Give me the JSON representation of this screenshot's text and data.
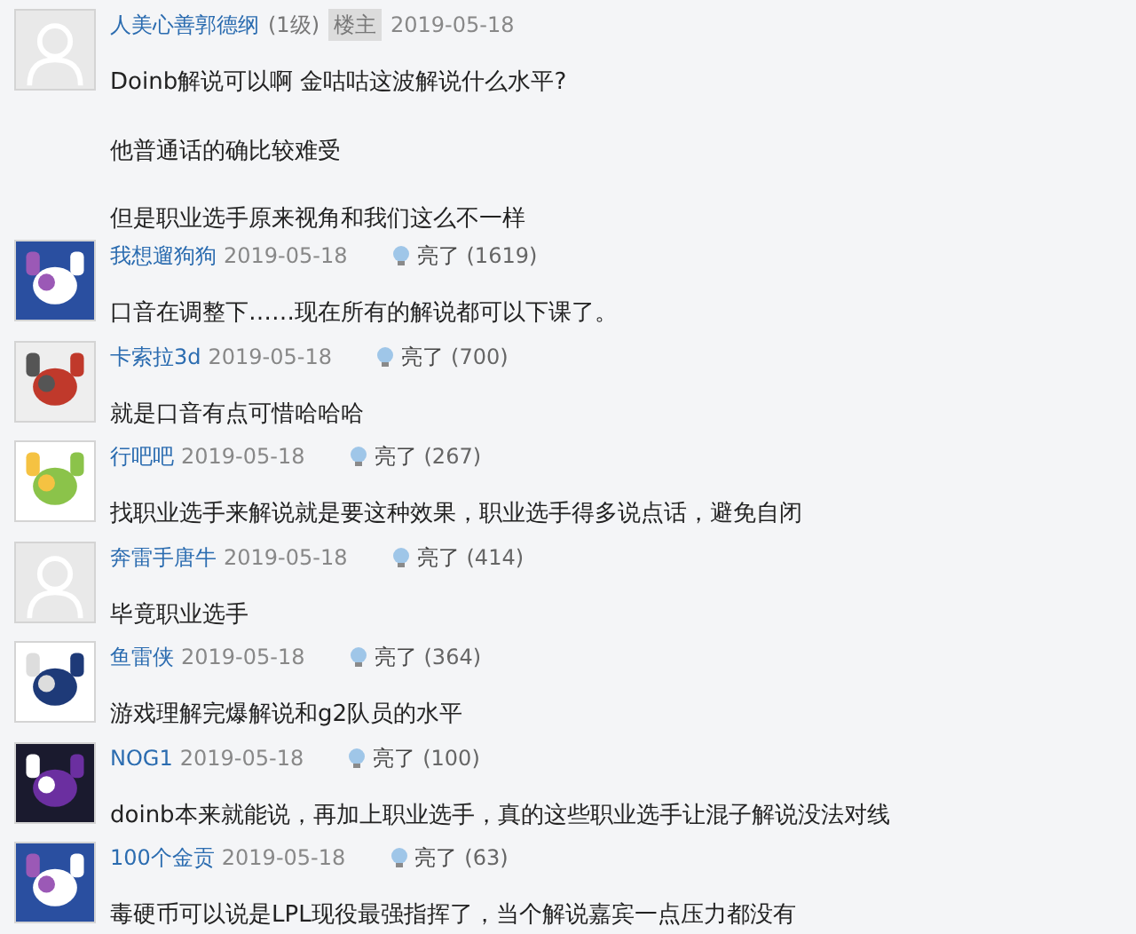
{
  "post": {
    "author": "人美心善郭德纲",
    "level": "(1级)",
    "badge": "楼主",
    "date": "2019-05-18",
    "avatar": {
      "kind": "default"
    },
    "paragraphs": [
      "Doinb解说可以啊 金咕咕这波解说什么水平?",
      "他普通话的确比较难受",
      "但是职业选手原来视角和我们这么不一样"
    ]
  },
  "replies": [
    {
      "author": "我想遛狗狗",
      "date": "2019-05-18",
      "like_label": "亮了",
      "like_count": "(1619)",
      "text": "口音在调整下……现在所有的解说都可以下课了。"
    },
    {
      "author": "卡索拉3d",
      "date": "2019-05-18",
      "like_label": "亮了",
      "like_count": "(700)",
      "text": "就是口音有点可惜哈哈哈"
    },
    {
      "author": "行吧吧",
      "date": "2019-05-18",
      "like_label": "亮了",
      "like_count": "(267)",
      "text": "找职业选手来解说就是要这种效果，职业选手得多说点话，避免自闭"
    },
    {
      "author": "奔雷手唐牛",
      "date": "2019-05-18",
      "like_label": "亮了",
      "like_count": "(414)",
      "text": "毕竟职业选手",
      "avatar": {
        "kind": "default"
      }
    },
    {
      "author": "鱼雷侠",
      "date": "2019-05-18",
      "like_label": "亮了",
      "like_count": "(364)",
      "text": "游戏理解完爆解说和g2队员的水平"
    },
    {
      "author": "NOG1",
      "date": "2019-05-18",
      "like_label": "亮了",
      "like_count": "(100)",
      "text": "doinb本来就能说，再加上职业选手，真的这些职业选手让混子解说没法对线"
    },
    {
      "author": "100个金贡",
      "date": "2019-05-18",
      "like_label": "亮了",
      "like_count": "(63)",
      "text": "毒硬币可以说是LPL现役最强指挥了，当个解说嘉宾一点压力都没有"
    }
  ]
}
